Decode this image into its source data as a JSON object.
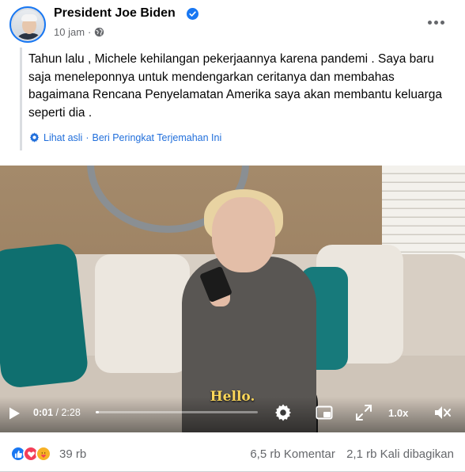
{
  "post": {
    "page_name": "President Joe Biden",
    "timestamp": "10 jam",
    "separator": "·",
    "text": "Tahun lalu , Michele kehilangan pekerjaannya karena pandemi . Saya baru saja meneleponnya untuk mendengarkan ceritanya dan membahas bagaimana Rencana Penyelamatan Amerika saya akan membantu keluarga seperti dia .",
    "see_original": "Lihat asli",
    "rate_translation": "Beri Peringkat Terjemahan Ini",
    "translation_separator": "·"
  },
  "video": {
    "subtitle": "Hello.",
    "current_time": "0:01",
    "duration": "/ 2:28",
    "progress_fraction": 0.007,
    "speed": "1.0x"
  },
  "footer": {
    "reaction_count": "39 rb",
    "comments": "6,5 rb Komentar",
    "shares": "2,1 rb Kali dibagikan"
  },
  "colors": {
    "link_blue": "#216fdb",
    "verified_blue": "#1877f2",
    "secondary_text": "#65676b",
    "subtitle_yellow": "#ffd95a"
  },
  "icons": [
    "verified-badge-icon",
    "globe-icon",
    "more-options-icon",
    "translation-gear-icon",
    "play-icon",
    "settings-gear-icon",
    "picture-in-picture-icon",
    "fullscreen-icon",
    "volume-icon",
    "like-reaction-icon",
    "love-reaction-icon",
    "care-reaction-icon"
  ]
}
